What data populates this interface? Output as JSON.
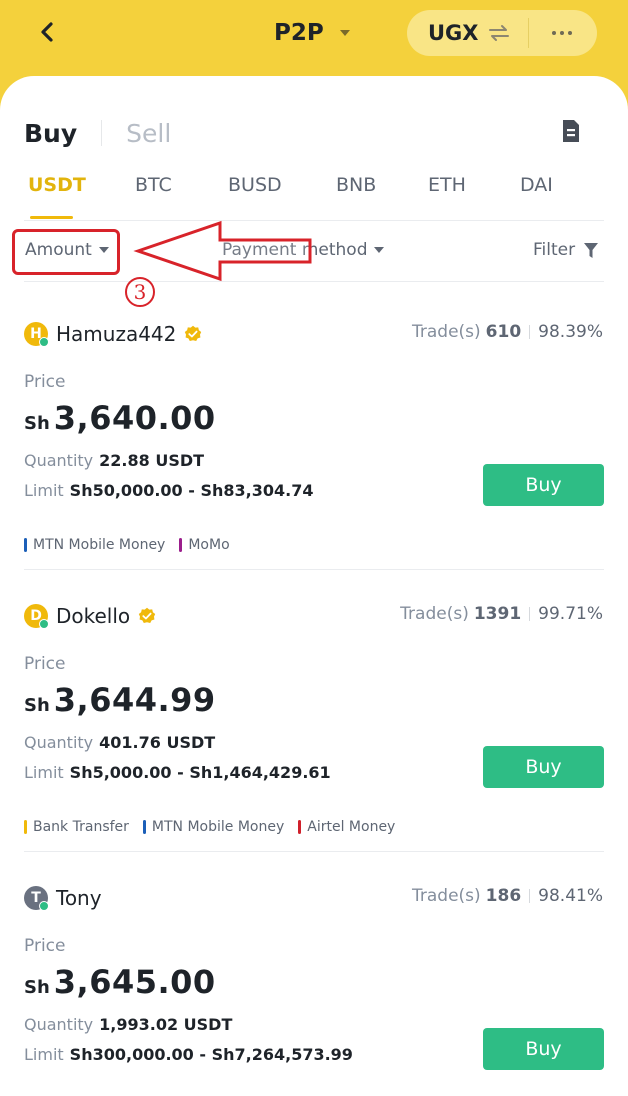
{
  "header": {
    "title": "P2P",
    "currency": "UGX",
    "back_icon": "chevron-left-icon",
    "swap_icon": "swap-arrows-icon",
    "more_icon": "more-horizontal-icon",
    "background": "#f4d13c"
  },
  "tabs": {
    "buy": "Buy",
    "sell": "Sell"
  },
  "coins": [
    "USDT",
    "BTC",
    "BUSD",
    "BNB",
    "ETH",
    "DAI"
  ],
  "active_coin": "USDT",
  "filters": {
    "amount": "Amount",
    "payment": "Payment method",
    "filter": "Filter"
  },
  "annotation": {
    "step": "3",
    "color": "#d8232a"
  },
  "labels": {
    "price": "Price",
    "quantity": "Quantity",
    "limit": "Limit",
    "trades": "Trade(s)",
    "currency_symbol": "Sh",
    "buy": "Buy"
  },
  "ads": [
    {
      "name": "Hamuza442",
      "initial": "H",
      "avatar_color": "#f0b90b",
      "trades": "610",
      "completion": "98.39%",
      "price": "3,640.00",
      "quantity": "22.88 USDT",
      "limit": "Sh50,000.00 - Sh83,304.74",
      "payments": [
        {
          "name": "MTN Mobile Money",
          "color": "#1c5fb8"
        },
        {
          "name": "MoMo",
          "color": "#9b1e8c"
        }
      ]
    },
    {
      "name": "Dokello",
      "initial": "D",
      "avatar_color": "#f0b90b",
      "trades": "1391",
      "completion": "99.71%",
      "price": "3,644.99",
      "quantity": "401.76 USDT",
      "limit": "Sh5,000.00 - Sh1,464,429.61",
      "payments": [
        {
          "name": "Bank Transfer",
          "color": "#f0b90b"
        },
        {
          "name": "MTN Mobile Money",
          "color": "#1c5fb8"
        },
        {
          "name": "Airtel Money",
          "color": "#d0202b"
        }
      ]
    },
    {
      "name": "Tony",
      "initial": "T",
      "avatar_color": "#6a7180",
      "trades": "186",
      "completion": "98.41%",
      "price": "3,645.00",
      "quantity": "1,993.02 USDT",
      "limit": "Sh300,000.00 - Sh7,264,573.99",
      "payments": []
    }
  ]
}
